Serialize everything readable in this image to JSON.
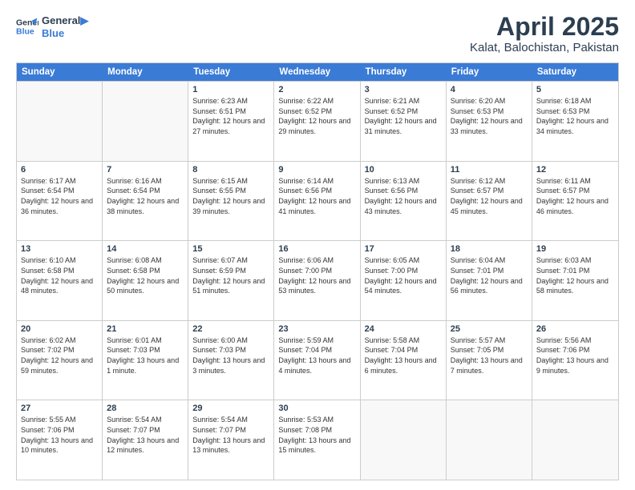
{
  "logo": {
    "line1": "General",
    "line2": "Blue"
  },
  "title": "April 2025",
  "subtitle": "Kalat, Balochistan, Pakistan",
  "weekdays": [
    "Sunday",
    "Monday",
    "Tuesday",
    "Wednesday",
    "Thursday",
    "Friday",
    "Saturday"
  ],
  "weeks": [
    [
      {
        "day": "",
        "sunrise": "",
        "sunset": "",
        "daylight": ""
      },
      {
        "day": "",
        "sunrise": "",
        "sunset": "",
        "daylight": ""
      },
      {
        "day": "1",
        "sunrise": "Sunrise: 6:23 AM",
        "sunset": "Sunset: 6:51 PM",
        "daylight": "Daylight: 12 hours and 27 minutes."
      },
      {
        "day": "2",
        "sunrise": "Sunrise: 6:22 AM",
        "sunset": "Sunset: 6:52 PM",
        "daylight": "Daylight: 12 hours and 29 minutes."
      },
      {
        "day": "3",
        "sunrise": "Sunrise: 6:21 AM",
        "sunset": "Sunset: 6:52 PM",
        "daylight": "Daylight: 12 hours and 31 minutes."
      },
      {
        "day": "4",
        "sunrise": "Sunrise: 6:20 AM",
        "sunset": "Sunset: 6:53 PM",
        "daylight": "Daylight: 12 hours and 33 minutes."
      },
      {
        "day": "5",
        "sunrise": "Sunrise: 6:18 AM",
        "sunset": "Sunset: 6:53 PM",
        "daylight": "Daylight: 12 hours and 34 minutes."
      }
    ],
    [
      {
        "day": "6",
        "sunrise": "Sunrise: 6:17 AM",
        "sunset": "Sunset: 6:54 PM",
        "daylight": "Daylight: 12 hours and 36 minutes."
      },
      {
        "day": "7",
        "sunrise": "Sunrise: 6:16 AM",
        "sunset": "Sunset: 6:54 PM",
        "daylight": "Daylight: 12 hours and 38 minutes."
      },
      {
        "day": "8",
        "sunrise": "Sunrise: 6:15 AM",
        "sunset": "Sunset: 6:55 PM",
        "daylight": "Daylight: 12 hours and 39 minutes."
      },
      {
        "day": "9",
        "sunrise": "Sunrise: 6:14 AM",
        "sunset": "Sunset: 6:56 PM",
        "daylight": "Daylight: 12 hours and 41 minutes."
      },
      {
        "day": "10",
        "sunrise": "Sunrise: 6:13 AM",
        "sunset": "Sunset: 6:56 PM",
        "daylight": "Daylight: 12 hours and 43 minutes."
      },
      {
        "day": "11",
        "sunrise": "Sunrise: 6:12 AM",
        "sunset": "Sunset: 6:57 PM",
        "daylight": "Daylight: 12 hours and 45 minutes."
      },
      {
        "day": "12",
        "sunrise": "Sunrise: 6:11 AM",
        "sunset": "Sunset: 6:57 PM",
        "daylight": "Daylight: 12 hours and 46 minutes."
      }
    ],
    [
      {
        "day": "13",
        "sunrise": "Sunrise: 6:10 AM",
        "sunset": "Sunset: 6:58 PM",
        "daylight": "Daylight: 12 hours and 48 minutes."
      },
      {
        "day": "14",
        "sunrise": "Sunrise: 6:08 AM",
        "sunset": "Sunset: 6:58 PM",
        "daylight": "Daylight: 12 hours and 50 minutes."
      },
      {
        "day": "15",
        "sunrise": "Sunrise: 6:07 AM",
        "sunset": "Sunset: 6:59 PM",
        "daylight": "Daylight: 12 hours and 51 minutes."
      },
      {
        "day": "16",
        "sunrise": "Sunrise: 6:06 AM",
        "sunset": "Sunset: 7:00 PM",
        "daylight": "Daylight: 12 hours and 53 minutes."
      },
      {
        "day": "17",
        "sunrise": "Sunrise: 6:05 AM",
        "sunset": "Sunset: 7:00 PM",
        "daylight": "Daylight: 12 hours and 54 minutes."
      },
      {
        "day": "18",
        "sunrise": "Sunrise: 6:04 AM",
        "sunset": "Sunset: 7:01 PM",
        "daylight": "Daylight: 12 hours and 56 minutes."
      },
      {
        "day": "19",
        "sunrise": "Sunrise: 6:03 AM",
        "sunset": "Sunset: 7:01 PM",
        "daylight": "Daylight: 12 hours and 58 minutes."
      }
    ],
    [
      {
        "day": "20",
        "sunrise": "Sunrise: 6:02 AM",
        "sunset": "Sunset: 7:02 PM",
        "daylight": "Daylight: 12 hours and 59 minutes."
      },
      {
        "day": "21",
        "sunrise": "Sunrise: 6:01 AM",
        "sunset": "Sunset: 7:03 PM",
        "daylight": "Daylight: 13 hours and 1 minute."
      },
      {
        "day": "22",
        "sunrise": "Sunrise: 6:00 AM",
        "sunset": "Sunset: 7:03 PM",
        "daylight": "Daylight: 13 hours and 3 minutes."
      },
      {
        "day": "23",
        "sunrise": "Sunrise: 5:59 AM",
        "sunset": "Sunset: 7:04 PM",
        "daylight": "Daylight: 13 hours and 4 minutes."
      },
      {
        "day": "24",
        "sunrise": "Sunrise: 5:58 AM",
        "sunset": "Sunset: 7:04 PM",
        "daylight": "Daylight: 13 hours and 6 minutes."
      },
      {
        "day": "25",
        "sunrise": "Sunrise: 5:57 AM",
        "sunset": "Sunset: 7:05 PM",
        "daylight": "Daylight: 13 hours and 7 minutes."
      },
      {
        "day": "26",
        "sunrise": "Sunrise: 5:56 AM",
        "sunset": "Sunset: 7:06 PM",
        "daylight": "Daylight: 13 hours and 9 minutes."
      }
    ],
    [
      {
        "day": "27",
        "sunrise": "Sunrise: 5:55 AM",
        "sunset": "Sunset: 7:06 PM",
        "daylight": "Daylight: 13 hours and 10 minutes."
      },
      {
        "day": "28",
        "sunrise": "Sunrise: 5:54 AM",
        "sunset": "Sunset: 7:07 PM",
        "daylight": "Daylight: 13 hours and 12 minutes."
      },
      {
        "day": "29",
        "sunrise": "Sunrise: 5:54 AM",
        "sunset": "Sunset: 7:07 PM",
        "daylight": "Daylight: 13 hours and 13 minutes."
      },
      {
        "day": "30",
        "sunrise": "Sunrise: 5:53 AM",
        "sunset": "Sunset: 7:08 PM",
        "daylight": "Daylight: 13 hours and 15 minutes."
      },
      {
        "day": "",
        "sunrise": "",
        "sunset": "",
        "daylight": ""
      },
      {
        "day": "",
        "sunrise": "",
        "sunset": "",
        "daylight": ""
      },
      {
        "day": "",
        "sunrise": "",
        "sunset": "",
        "daylight": ""
      }
    ]
  ]
}
